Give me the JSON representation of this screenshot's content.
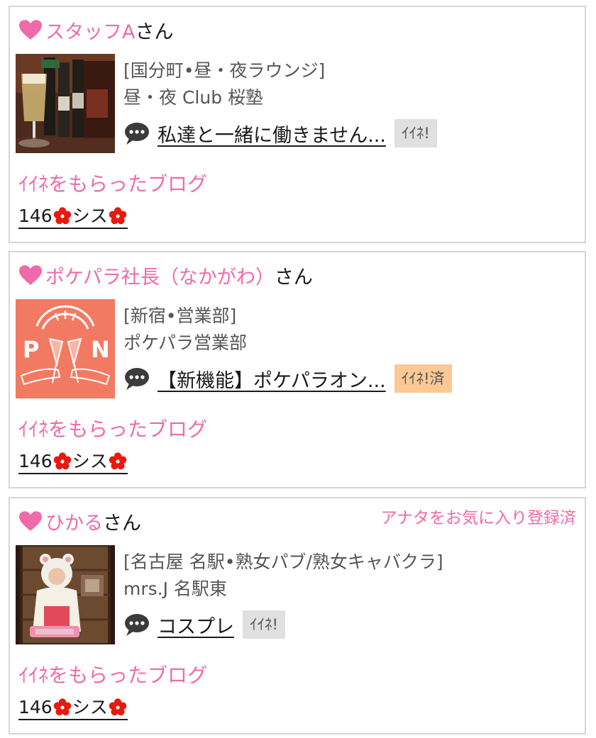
{
  "colors": {
    "accent_pink": "#ef6aa9",
    "iine_gray": "#e0e0e0",
    "iine_done": "#fcc894",
    "flower_red": "#e8190e"
  },
  "cards": [
    {
      "name": "スタッフA",
      "honorific": "さん",
      "category": "[国分町•昼・夜ラウンジ]",
      "shop": "昼・夜 Club 桜塾",
      "blog_title": "私達と一緒に働きません...",
      "iine_label": "ｲｲﾈ!",
      "section_label": "ｲｲﾈをもらったブログ",
      "count_prefix": "146",
      "count_suffix": "シス"
    },
    {
      "name": "ポケパラ社長（なかがわ）",
      "honorific": "さん",
      "category": "[新宿•営業部]",
      "shop": "ポケパラ営業部",
      "blog_title": "【新機能】ポケパラオン...",
      "iine_label": "ｲｲﾈ!済",
      "thumb_text_left": "P",
      "thumb_text_right": "N",
      "section_label": "ｲｲﾈをもらったブログ",
      "count_prefix": "146",
      "count_suffix": "シス"
    },
    {
      "name": "ひかる",
      "honorific": "さん",
      "favorite_status": "アナタをお気に入り登録済",
      "category": "[名古屋 名駅•熟女パブ/熟女キャバクラ]",
      "shop": "mrs.J 名駅東",
      "blog_title": "コスプレ",
      "iine_label": "ｲｲﾈ!",
      "section_label": "ｲｲﾈをもらったブログ",
      "count_prefix": "146",
      "count_suffix": "シス"
    }
  ]
}
